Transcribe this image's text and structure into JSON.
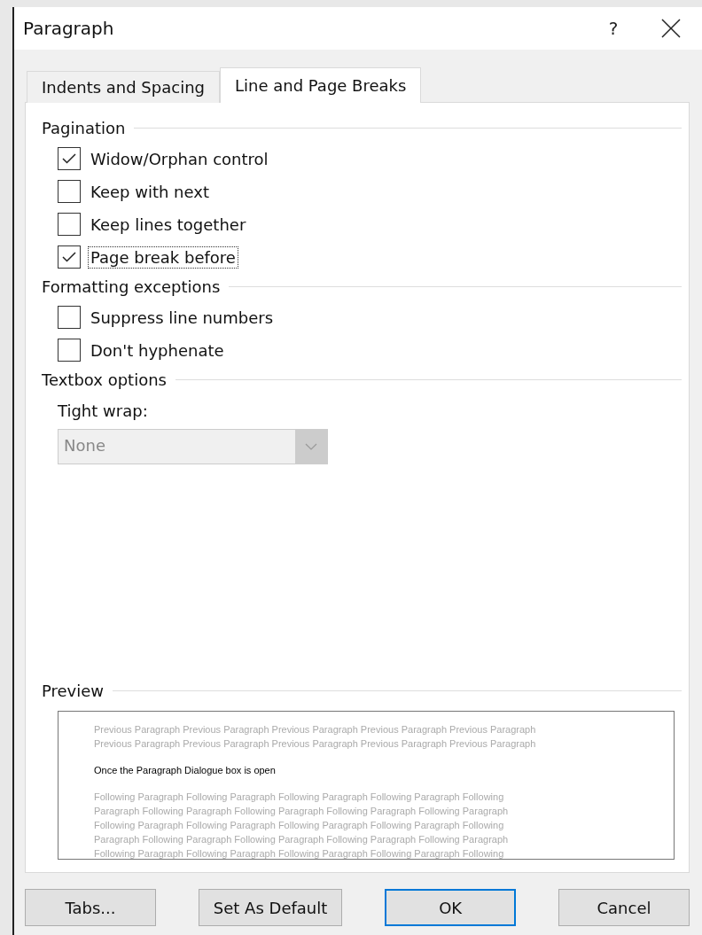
{
  "window": {
    "title": "Paragraph",
    "help": "?"
  },
  "tabs": [
    {
      "label": "Indents and Spacing",
      "selected": false
    },
    {
      "label": "Line and Page Breaks",
      "selected": true
    }
  ],
  "sections": [
    {
      "title": "Pagination",
      "checkboxes": [
        {
          "label": "Widow/Orphan control",
          "checked": true,
          "focused": false
        },
        {
          "label": "Keep with next",
          "checked": false,
          "focused": false
        },
        {
          "label": "Keep lines together",
          "checked": false,
          "focused": false
        },
        {
          "label": "Page break before",
          "checked": true,
          "focused": true
        }
      ]
    },
    {
      "title": "Formatting exceptions",
      "checkboxes": [
        {
          "label": "Suppress line numbers",
          "checked": false,
          "focused": false
        },
        {
          "label": "Don't hyphenate",
          "checked": false,
          "focused": false
        }
      ]
    },
    {
      "title": "Textbox options",
      "dropdown": {
        "label": "Tight wrap:",
        "value": "None",
        "disabled": true
      }
    }
  ],
  "preview": {
    "title": "Preview",
    "previous_lines": [
      "Previous Paragraph Previous Paragraph Previous Paragraph Previous Paragraph Previous Paragraph",
      "Previous Paragraph Previous Paragraph Previous Paragraph Previous Paragraph Previous Paragraph"
    ],
    "current": "Once the Paragraph Dialogue box is open",
    "following_lines": [
      "Following Paragraph Following Paragraph Following Paragraph Following Paragraph Following",
      "Paragraph Following Paragraph Following Paragraph Following Paragraph Following Paragraph",
      "Following Paragraph Following Paragraph Following Paragraph Following Paragraph Following",
      "Paragraph Following Paragraph Following Paragraph Following Paragraph Following Paragraph",
      "Following Paragraph Following Paragraph Following Paragraph Following Paragraph Following"
    ]
  },
  "buttons": [
    {
      "label": "Tabs...",
      "default": false
    },
    {
      "label": "Set As Default",
      "default": false
    },
    {
      "label": "OK",
      "default": true
    },
    {
      "label": "Cancel",
      "default": false
    }
  ]
}
